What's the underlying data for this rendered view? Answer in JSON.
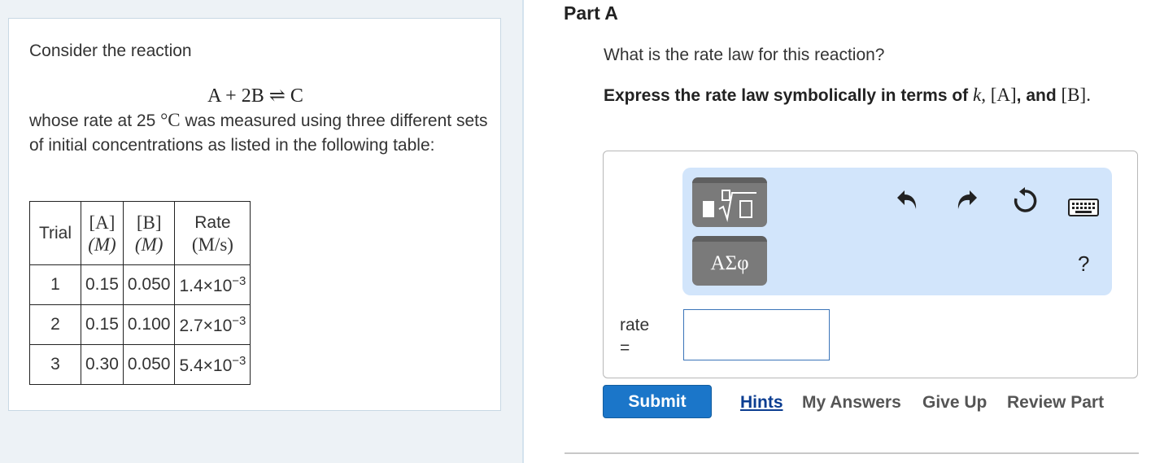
{
  "problem": {
    "intro": "Consider the reaction",
    "equation_lhs": "A + 2B",
    "equation_arrow": "⇌",
    "equation_rhs": "C",
    "desc_before": "whose rate at 25 ",
    "temp_unit": "°C",
    "desc_after": " was measured using three different sets of initial concentrations as listed in the following table:",
    "table": {
      "headers": {
        "trial": "Trial",
        "a_top": "[A]",
        "a_unit": "(M)",
        "b_top": "[B]",
        "b_unit": "(M)",
        "rate_top": "Rate",
        "rate_unit": "(M/s)"
      },
      "rows": [
        {
          "trial": "1",
          "a": "0.15",
          "b": "0.050",
          "rate_base": "1.4×10",
          "rate_exp": "−3"
        },
        {
          "trial": "2",
          "a": "0.15",
          "b": "0.100",
          "rate_base": "2.7×10",
          "rate_exp": "−3"
        },
        {
          "trial": "3",
          "a": "0.30",
          "b": "0.050",
          "rate_base": "5.4×10",
          "rate_exp": "−3"
        }
      ]
    }
  },
  "part": {
    "title": "Part A",
    "question": "What is the rate law for this reaction?",
    "instruction_before": "Express the rate law symbolically in terms of ",
    "sym_k": "k",
    "sep1": ", ",
    "sym_a": "[A]",
    "instruction_and": ", and ",
    "sym_b": "[B]",
    "end": "."
  },
  "toolbar": {
    "templates_icon": "▮√▯",
    "symbols_label": "ΑΣφ",
    "help_label": "?",
    "icons": {
      "undo": "undo-icon",
      "redo": "redo-icon",
      "reset": "reset-icon",
      "keyboard": "keyboard-icon"
    }
  },
  "answer": {
    "label_line1": "rate",
    "label_line2": "=",
    "value": ""
  },
  "actions": {
    "submit": "Submit",
    "hints": "Hints",
    "my_answers": "My Answers",
    "give_up": "Give Up",
    "review_part": "Review Part"
  },
  "colors": {
    "submit_bg": "#1b76c9",
    "toolbar_bg": "#d2e5fb",
    "hints_link": "#0b3d91",
    "pane_bg": "#edf2f6"
  }
}
